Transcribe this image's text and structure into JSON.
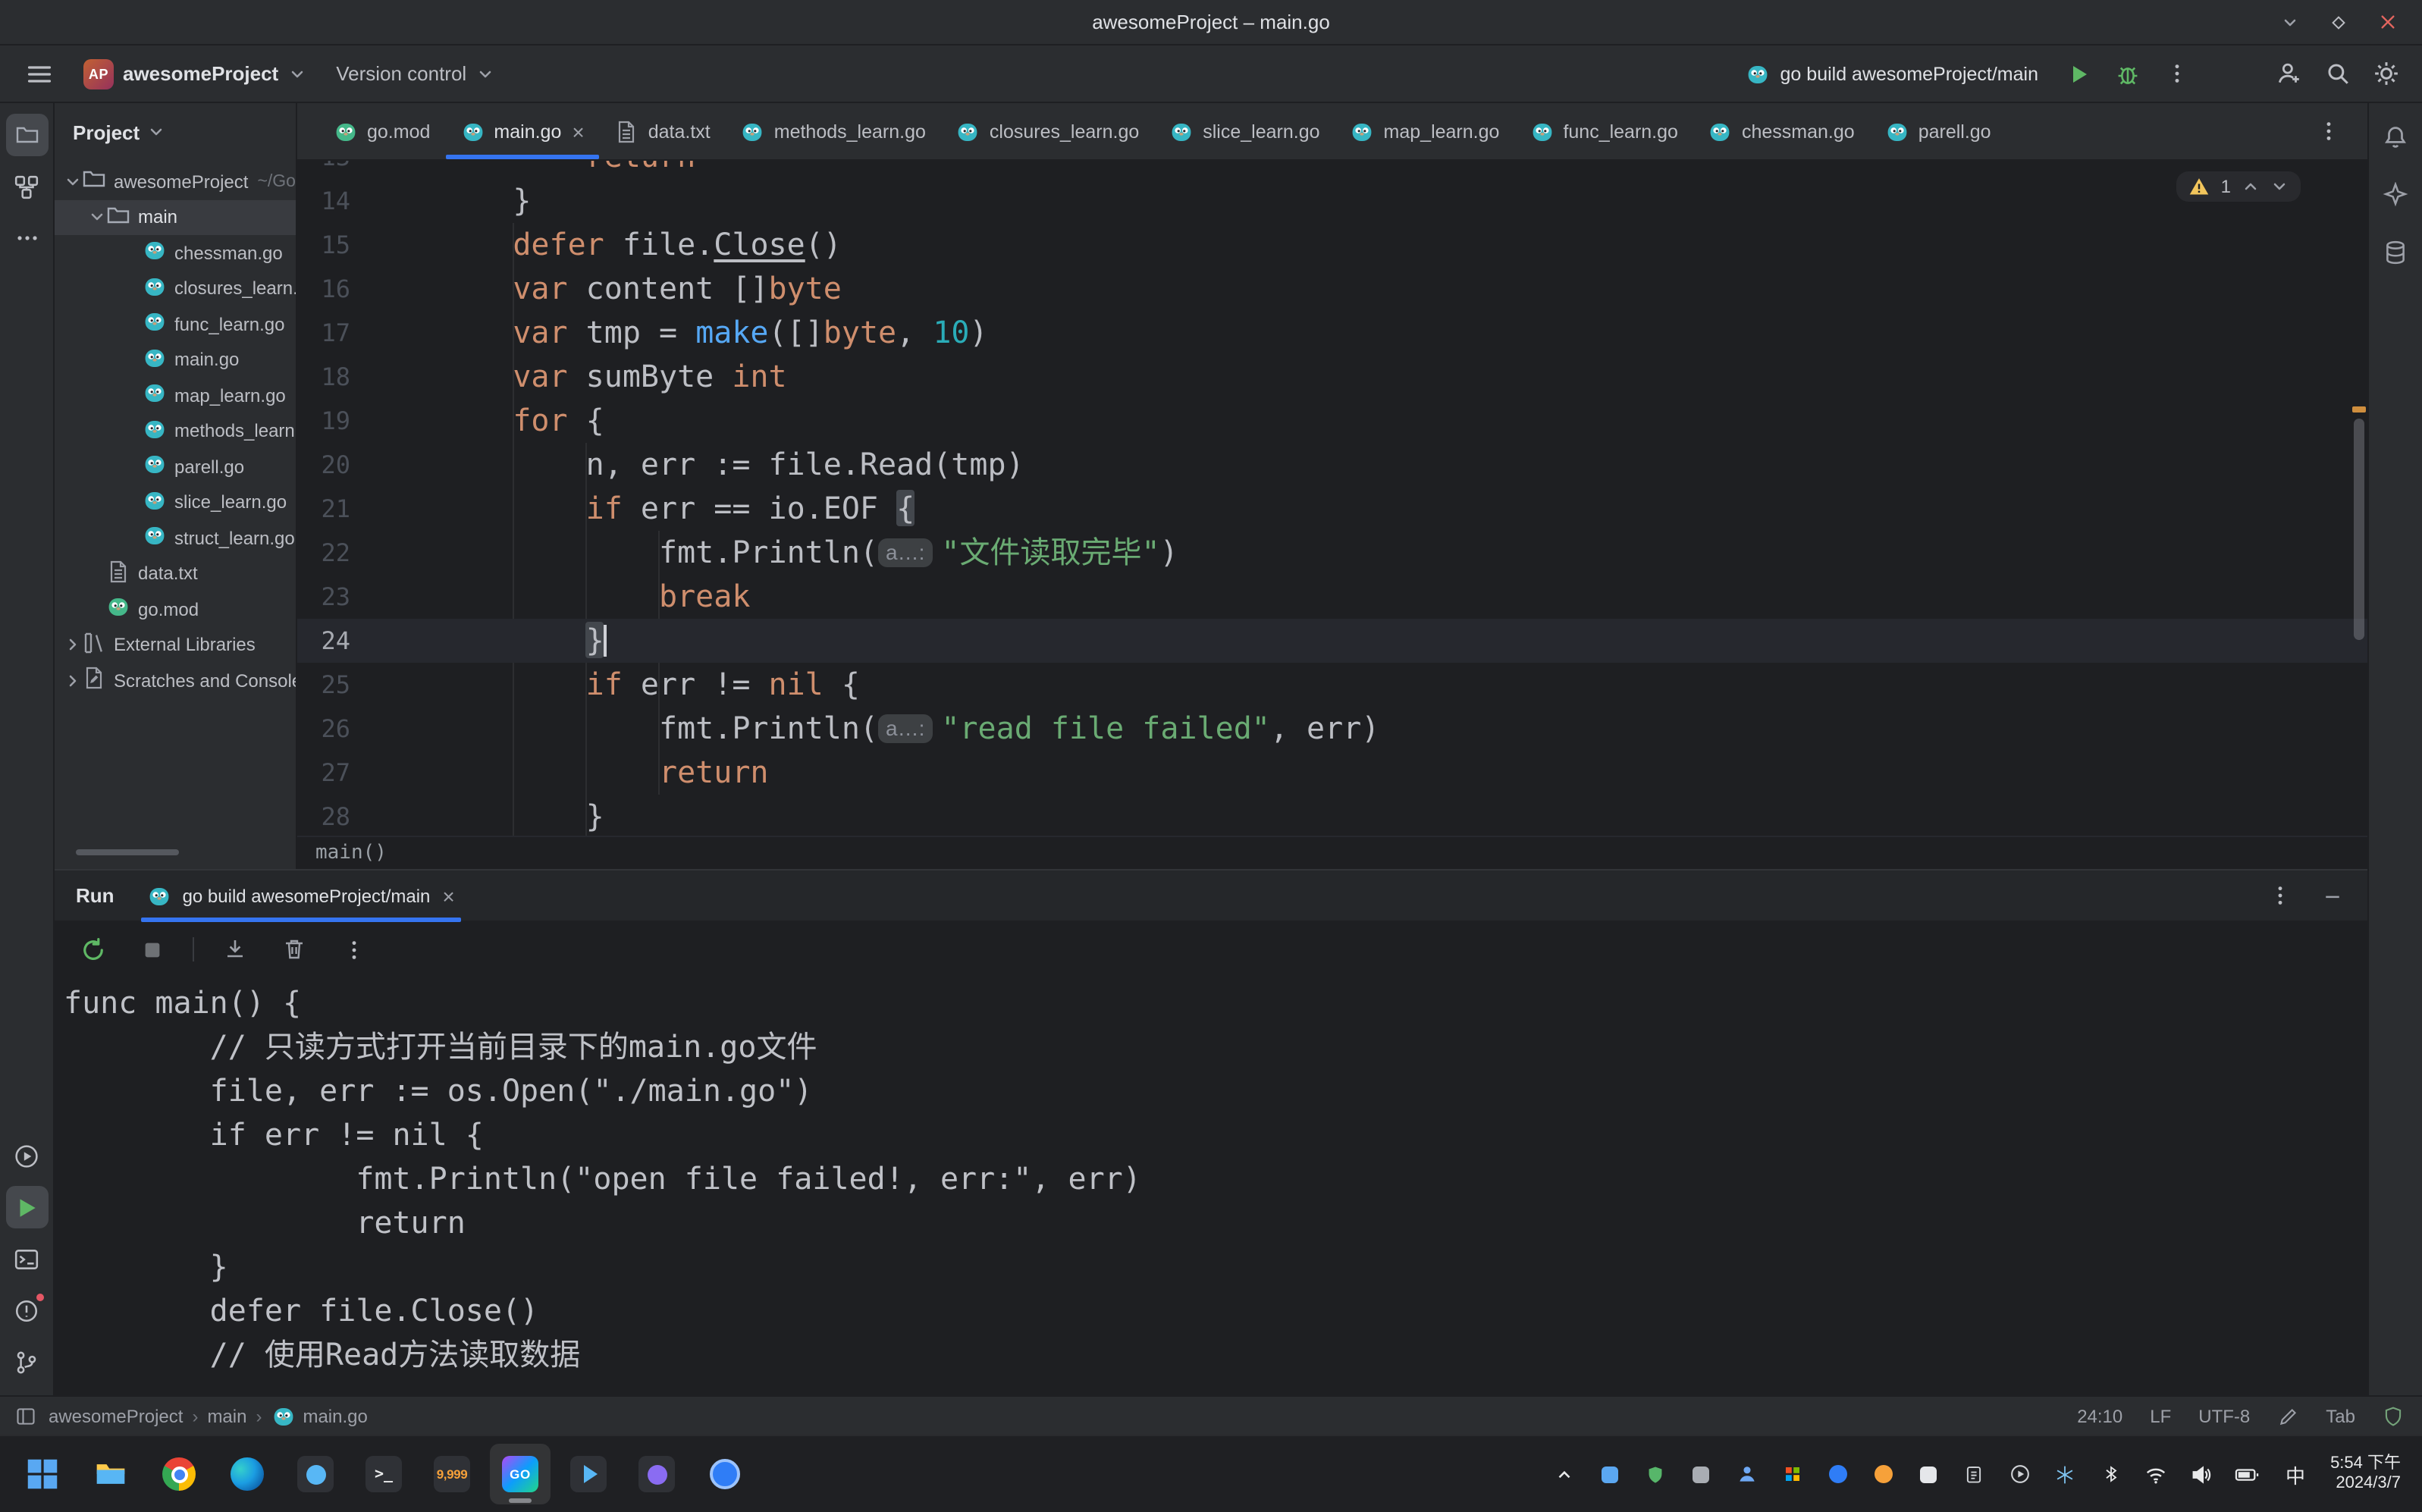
{
  "titlebar": {
    "title": "awesomeProject – main.go"
  },
  "toolbar": {
    "project_badge": "AP",
    "project_name": "awesomeProject",
    "version_control_label": "Version control",
    "run_config_label": "go build awesomeProject/main"
  },
  "left_stripe": {
    "top": [
      {
        "icon": "folder",
        "name": "project-tool-button",
        "active": true
      },
      {
        "icon": "structure",
        "name": "structure-tool-button"
      },
      {
        "icon": "moreh",
        "name": "more-tools-button"
      }
    ],
    "bottom": [
      {
        "icon": "services",
        "name": "services-tool-button"
      },
      {
        "icon": "run",
        "name": "run-tool-button",
        "active": true
      },
      {
        "icon": "terminal",
        "name": "terminal-tool-button"
      },
      {
        "icon": "problems",
        "name": "problems-tool-button",
        "badge": true
      },
      {
        "icon": "branch",
        "name": "version-control-tool-button"
      }
    ]
  },
  "right_stripe": [
    {
      "icon": "bell",
      "name": "notifications-button"
    },
    {
      "icon": "ai",
      "name": "ai-assistant-button"
    },
    {
      "icon": "database",
      "name": "database-button"
    }
  ],
  "project_panel": {
    "header_label": "Project",
    "tree": [
      {
        "label": "awesomeProject",
        "hint": "~/Gola",
        "icon": "folder",
        "level": 0,
        "chevron": "down"
      },
      {
        "label": "main",
        "icon": "folder",
        "level": 1,
        "chevron": "down",
        "selected": true
      },
      {
        "label": "chessman.go",
        "icon": "gofile",
        "level": 2
      },
      {
        "label": "closures_learn.go",
        "icon": "gofile",
        "level": 2
      },
      {
        "label": "func_learn.go",
        "icon": "gofile",
        "level": 2
      },
      {
        "label": "main.go",
        "icon": "gofile",
        "level": 2
      },
      {
        "label": "map_learn.go",
        "icon": "gofile",
        "level": 2
      },
      {
        "label": "methods_learn.go",
        "icon": "gofile",
        "level": 2
      },
      {
        "label": "parell.go",
        "icon": "gofile",
        "level": 2
      },
      {
        "label": "slice_learn.go",
        "icon": "gofile",
        "level": 2
      },
      {
        "label": "struct_learn.go",
        "icon": "gofile",
        "level": 2
      },
      {
        "label": "data.txt",
        "icon": "textfile",
        "level": 1
      },
      {
        "label": "go.mod",
        "icon": "gomod",
        "level": 1
      },
      {
        "label": "External Libraries",
        "icon": "libraries",
        "level": 0,
        "chevron": "right"
      },
      {
        "label": "Scratches and Consoles",
        "icon": "scratches",
        "level": 0,
        "chevron": "right"
      }
    ]
  },
  "editor": {
    "tabs": [
      {
        "label": "go.mod",
        "icon": "gomod"
      },
      {
        "label": "main.go",
        "icon": "gofile",
        "active": true,
        "closable": true
      },
      {
        "label": "data.txt",
        "icon": "textfile"
      },
      {
        "label": "methods_learn.go",
        "icon": "gofile"
      },
      {
        "label": "closures_learn.go",
        "icon": "gofile"
      },
      {
        "label": "slice_learn.go",
        "icon": "gofile"
      },
      {
        "label": "map_learn.go",
        "icon": "gofile"
      },
      {
        "label": "func_learn.go",
        "icon": "gofile"
      },
      {
        "label": "chessman.go",
        "icon": "gofile"
      },
      {
        "label": "parell.go",
        "icon": "gofile"
      }
    ],
    "inspection_widget": {
      "warning_count": "1"
    },
    "code_lines": [
      {
        "n": 13,
        "tokens": [
          [
            "d",
            "\t\t"
          ],
          [
            "k",
            "return"
          ]
        ]
      },
      {
        "n": 14,
        "tokens": [
          [
            "d",
            "\t}"
          ]
        ]
      },
      {
        "n": 15,
        "tokens": [
          [
            "d",
            "\t"
          ],
          [
            "k",
            "defer"
          ],
          [
            "d",
            " file."
          ],
          [
            "u",
            "Close"
          ],
          [
            "d",
            "()"
          ]
        ]
      },
      {
        "n": 16,
        "tokens": [
          [
            "d",
            "\t"
          ],
          [
            "k",
            "var"
          ],
          [
            "d",
            " content []"
          ],
          [
            "k",
            "byte"
          ]
        ]
      },
      {
        "n": 17,
        "tokens": [
          [
            "d",
            "\t"
          ],
          [
            "k",
            "var"
          ],
          [
            "d",
            " tmp = "
          ],
          [
            "b",
            "make"
          ],
          [
            "d",
            "([]"
          ],
          [
            "k",
            "byte"
          ],
          [
            "d",
            ", "
          ],
          [
            "n",
            "10"
          ],
          [
            "d",
            ")"
          ]
        ]
      },
      {
        "n": 18,
        "tokens": [
          [
            "d",
            "\t"
          ],
          [
            "k",
            "var"
          ],
          [
            "d",
            " sumByte "
          ],
          [
            "k",
            "int"
          ]
        ]
      },
      {
        "n": 19,
        "tokens": [
          [
            "d",
            "\t"
          ],
          [
            "k",
            "for"
          ],
          [
            "d",
            " {"
          ]
        ]
      },
      {
        "n": 20,
        "tokens": [
          [
            "d",
            "\t\tn, err := file.Read(tmp)"
          ]
        ]
      },
      {
        "n": 21,
        "tokens": [
          [
            "d",
            "\t\t"
          ],
          [
            "k",
            "if"
          ],
          [
            "d",
            " err == io.EOF "
          ],
          [
            "m",
            "{"
          ]
        ]
      },
      {
        "n": 22,
        "tokens": [
          [
            "d",
            "\t\t\tfmt.Println("
          ],
          [
            "h",
            "a…:"
          ],
          [
            "s",
            "\"文件读取完毕\""
          ],
          [
            "d",
            ")"
          ]
        ]
      },
      {
        "n": 23,
        "tokens": [
          [
            "d",
            "\t\t\t"
          ],
          [
            "k",
            "break"
          ]
        ]
      },
      {
        "n": 24,
        "tokens": [
          [
            "d",
            "\t\t"
          ],
          [
            "m",
            "}"
          ]
        ],
        "current": true,
        "caret": true
      },
      {
        "n": 25,
        "tokens": [
          [
            "d",
            "\t\t"
          ],
          [
            "k",
            "if"
          ],
          [
            "d",
            " err != "
          ],
          [
            "k",
            "nil"
          ],
          [
            "d",
            " {"
          ]
        ]
      },
      {
        "n": 26,
        "tokens": [
          [
            "d",
            "\t\t\tfmt.Println("
          ],
          [
            "h",
            "a…:"
          ],
          [
            "s",
            "\"read file failed\""
          ],
          [
            "d",
            ", err)"
          ]
        ]
      },
      {
        "n": 27,
        "tokens": [
          [
            "d",
            "\t\t\t"
          ],
          [
            "k",
            "return"
          ]
        ]
      },
      {
        "n": 28,
        "tokens": [
          [
            "d",
            "\t\t}"
          ]
        ]
      }
    ],
    "sticky_line": "main()"
  },
  "run_panel": {
    "title": "Run",
    "tab_label": "go build awesomeProject/main",
    "toolbar": [
      {
        "icon": "rerun",
        "name": "rerun-button"
      },
      {
        "icon": "stop",
        "name": "stop-button"
      },
      {
        "divider": true
      },
      {
        "icon": "scrollend",
        "name": "scroll-to-end-button"
      },
      {
        "icon": "trash",
        "name": "clear-console-button"
      },
      {
        "icon": "kebab",
        "name": "console-more-button"
      }
    ],
    "console_lines": [
      "func main() {",
      "\t// 只读方式打开当前目录下的main.go文件",
      "\tfile, err := os.Open(\"./main.go\")",
      "\tif err != nil {",
      "\t\tfmt.Println(\"open file failed!, err:\", err)",
      "\t\treturn",
      "\t}",
      "\tdefer file.Close()",
      "\t// 使用Read方法读取数据"
    ]
  },
  "status_bar": {
    "breadcrumbs": [
      "awesomeProject",
      "main",
      "main.go"
    ],
    "cursor_position": "24:10",
    "line_separator": "LF",
    "encoding": "UTF-8",
    "indent_style": "Tab"
  },
  "taskbar": {
    "apps": [
      {
        "name": "start"
      },
      {
        "name": "file-explorer"
      },
      {
        "name": "chrome"
      },
      {
        "name": "edge"
      },
      {
        "name": "pinned-app-blue"
      },
      {
        "name": "terminal"
      },
      {
        "name": "pinned-app-badge",
        "badge": "9,999"
      },
      {
        "name": "goland",
        "label": "GO",
        "focused": true
      },
      {
        "name": "media-player"
      },
      {
        "name": "pinned-app-purple"
      },
      {
        "name": "pinned-app-circle"
      }
    ],
    "tray_icons": [
      {
        "name": "hidden-icons-chevron"
      },
      {
        "name": "tray-app-blue"
      },
      {
        "name": "tray-shield-green"
      },
      {
        "name": "tray-app-gray"
      },
      {
        "name": "tray-person-blue"
      },
      {
        "name": "tray-ms-grid"
      },
      {
        "name": "tray-circle-blue"
      },
      {
        "name": "tray-circle-orange"
      },
      {
        "name": "tray-app-light"
      },
      {
        "name": "tray-clipboard"
      },
      {
        "name": "tray-media-play"
      },
      {
        "name": "tray-snowflake"
      },
      {
        "name": "tray-bluetooth"
      },
      {
        "name": "tray-network"
      },
      {
        "name": "tray-volume"
      },
      {
        "name": "tray-battery"
      }
    ],
    "ime": "中",
    "time": "5:54 下午",
    "date": "2024/3/7"
  }
}
